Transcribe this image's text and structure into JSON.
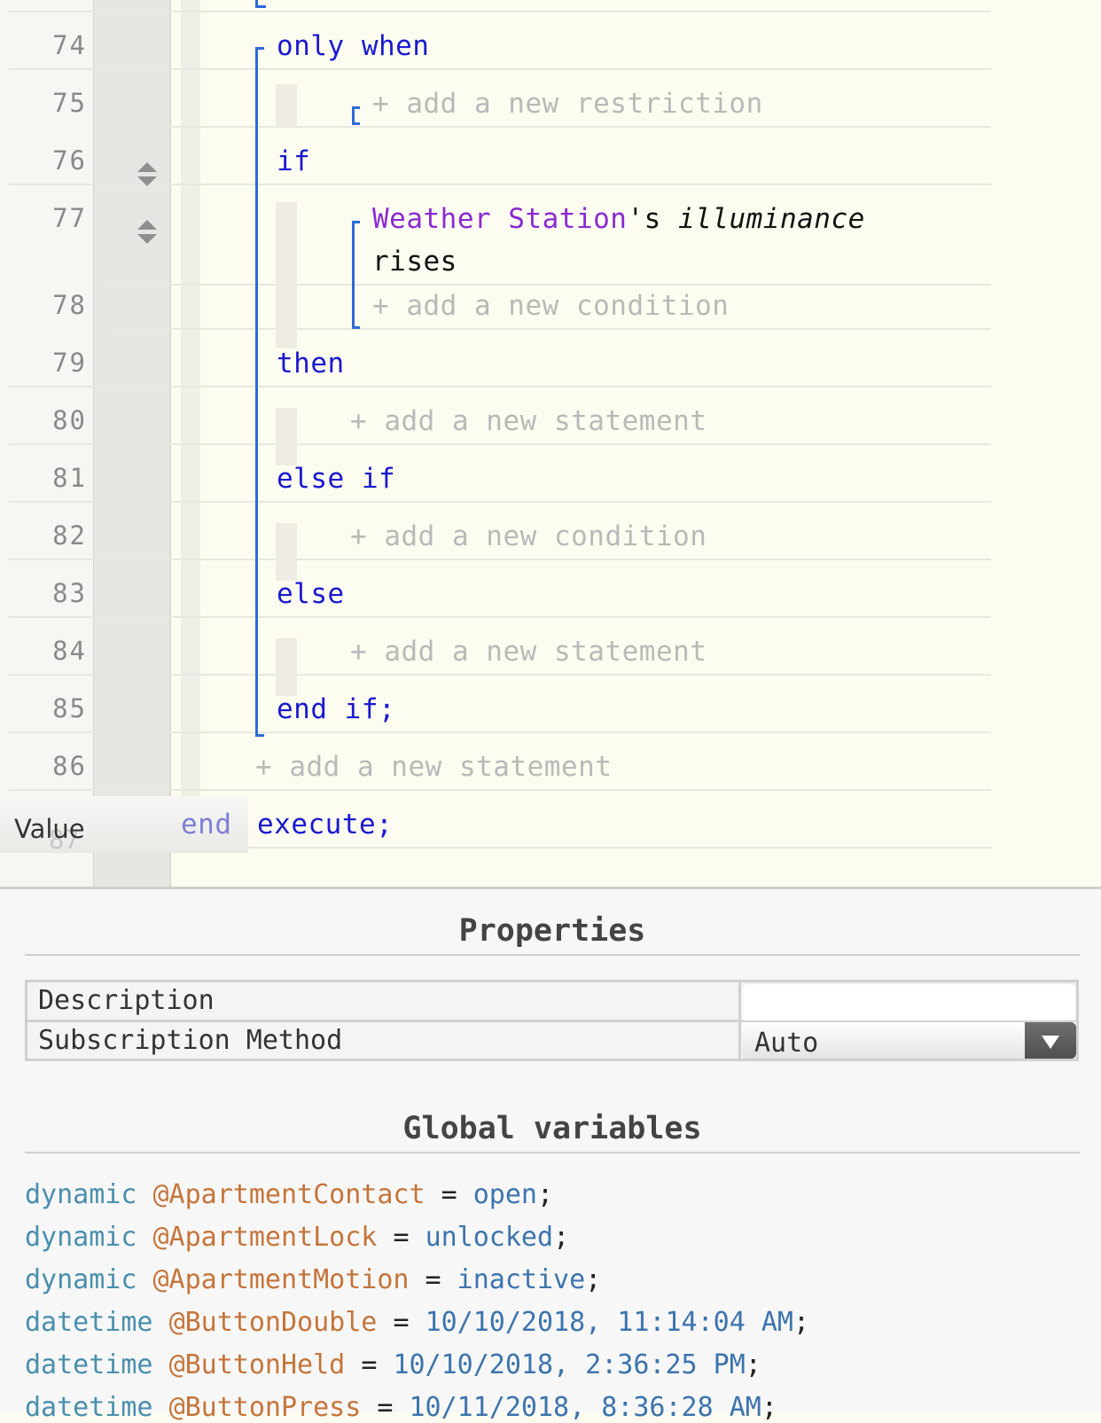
{
  "editor": {
    "lines": [
      {
        "num": "74"
      },
      {
        "num": "75"
      },
      {
        "num": "76"
      },
      {
        "num": "77"
      },
      {
        "num": "78"
      },
      {
        "num": "79"
      },
      {
        "num": "80"
      },
      {
        "num": "81"
      },
      {
        "num": "82"
      },
      {
        "num": "83"
      },
      {
        "num": "84"
      },
      {
        "num": "85"
      },
      {
        "num": "86"
      },
      {
        "num": "87"
      }
    ],
    "keywords": {
      "only_when": "only when",
      "if": "if",
      "then": "then",
      "else_if": "else if",
      "else": "else",
      "end_if": "end if;",
      "end": "end",
      "execute": "execute;"
    },
    "condition": {
      "device": "Weather Station",
      "possessive": "'s",
      "attribute": "illuminance",
      "comparison": "rises"
    },
    "placeholders": {
      "restriction": "+ add a new restriction",
      "condition": "+ add a new condition",
      "statement": "+ add a new statement"
    },
    "value_tab": "Value"
  },
  "properties": {
    "title": "Properties",
    "rows": [
      {
        "label": "Description",
        "value": ""
      },
      {
        "label": "Subscription Method",
        "value": "Auto"
      }
    ]
  },
  "globals": {
    "title": "Global variables",
    "items": [
      {
        "type": "dynamic",
        "name": "@ApartmentContact",
        "eq": "=",
        "value": "open",
        "semi": ";"
      },
      {
        "type": "dynamic",
        "name": "@ApartmentLock",
        "eq": "=",
        "value": "unlocked",
        "semi": ";"
      },
      {
        "type": "dynamic",
        "name": "@ApartmentMotion",
        "eq": "=",
        "value": "inactive",
        "semi": ";"
      },
      {
        "type": "datetime",
        "name": "@ButtonDouble",
        "eq": "=",
        "value": "10/10/2018, 11:14:04 AM",
        "semi": ";"
      },
      {
        "type": "datetime",
        "name": "@ButtonHeld",
        "eq": "=",
        "value": "10/10/2018, 2:36:25 PM",
        "semi": ";"
      },
      {
        "type": "datetime",
        "name": "@ButtonPress",
        "eq": "=",
        "value": "10/11/2018, 8:36:28 AM",
        "semi": ";"
      }
    ]
  }
}
